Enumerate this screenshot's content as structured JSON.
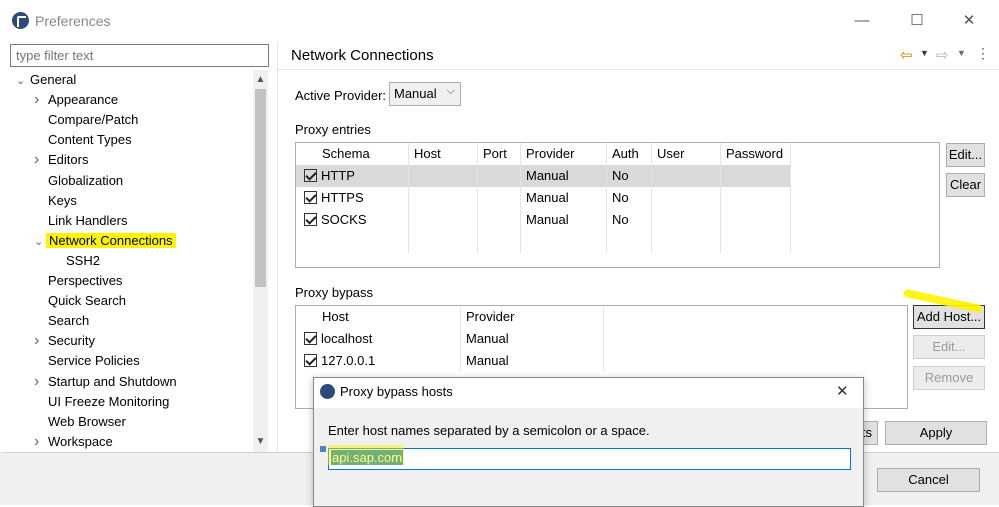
{
  "window": {
    "title": "Preferences",
    "minimize": "—",
    "maximize": "☐",
    "close": "✕"
  },
  "filter": {
    "placeholder": "type filter text"
  },
  "tree": {
    "items": [
      {
        "label": "General",
        "chevron": "v",
        "indent": 0
      },
      {
        "label": "Appearance",
        "chevron": ">",
        "indent": 1
      },
      {
        "label": "Compare/Patch",
        "chevron": "",
        "indent": 1
      },
      {
        "label": "Content Types",
        "chevron": "",
        "indent": 1
      },
      {
        "label": "Editors",
        "chevron": ">",
        "indent": 1
      },
      {
        "label": "Globalization",
        "chevron": "",
        "indent": 1
      },
      {
        "label": "Keys",
        "chevron": "",
        "indent": 1
      },
      {
        "label": "Link Handlers",
        "chevron": "",
        "indent": 1
      },
      {
        "label": "Network Connections",
        "chevron": "v",
        "indent": 1
      },
      {
        "label": "SSH2",
        "chevron": "",
        "indent": 2
      },
      {
        "label": "Perspectives",
        "chevron": "",
        "indent": 1
      },
      {
        "label": "Quick Search",
        "chevron": "",
        "indent": 1
      },
      {
        "label": "Search",
        "chevron": "",
        "indent": 1
      },
      {
        "label": "Security",
        "chevron": ">",
        "indent": 1
      },
      {
        "label": "Service Policies",
        "chevron": "",
        "indent": 1
      },
      {
        "label": "Startup and Shutdown",
        "chevron": ">",
        "indent": 1
      },
      {
        "label": "UI Freeze Monitoring",
        "chevron": "",
        "indent": 1
      },
      {
        "label": "Web Browser",
        "chevron": "",
        "indent": 1
      },
      {
        "label": "Workspace",
        "chevron": ">",
        "indent": 1
      }
    ],
    "selected": "Network Connections"
  },
  "page": {
    "title": "Network Connections",
    "active_provider_label": "Active Provider:",
    "active_provider_value": "Manual",
    "proxy_entries_label": "Proxy entries",
    "proxy_bypass_label": "Proxy bypass"
  },
  "proxy_entries": {
    "columns": [
      "Schema",
      "Host",
      "Port",
      "Provider",
      "Auth",
      "User",
      "Password"
    ],
    "rows": [
      {
        "schema": "HTTP",
        "host": "",
        "port": "",
        "provider": "Manual",
        "auth": "No",
        "user": "",
        "password": "",
        "checked": true
      },
      {
        "schema": "HTTPS",
        "host": "",
        "port": "",
        "provider": "Manual",
        "auth": "No",
        "user": "",
        "password": "",
        "checked": true
      },
      {
        "schema": "SOCKS",
        "host": "",
        "port": "",
        "provider": "Manual",
        "auth": "No",
        "user": "",
        "password": "",
        "checked": true
      }
    ],
    "buttons": {
      "edit": "Edit...",
      "clear": "Clear"
    }
  },
  "proxy_bypass": {
    "columns": [
      "Host",
      "Provider"
    ],
    "rows": [
      {
        "host": "localhost",
        "provider": "Manual",
        "checked": true
      },
      {
        "host": "127.0.0.1",
        "provider": "Manual",
        "checked": true
      }
    ],
    "buttons": {
      "add_host": "Add Host...",
      "edit": "Edit...",
      "remove": "Remove"
    }
  },
  "footer": {
    "restore_defaults_partial": "ts",
    "apply": "Apply",
    "cancel": "Cancel"
  },
  "dialog": {
    "title": "Proxy bypass hosts",
    "instruction": "Enter host names separated by a semicolon or a space.",
    "input_value": "api.sap.com"
  },
  "colors": {
    "highlight": "#fff400",
    "selection": "#0078d7",
    "row_selected": "#d9d9d9"
  }
}
